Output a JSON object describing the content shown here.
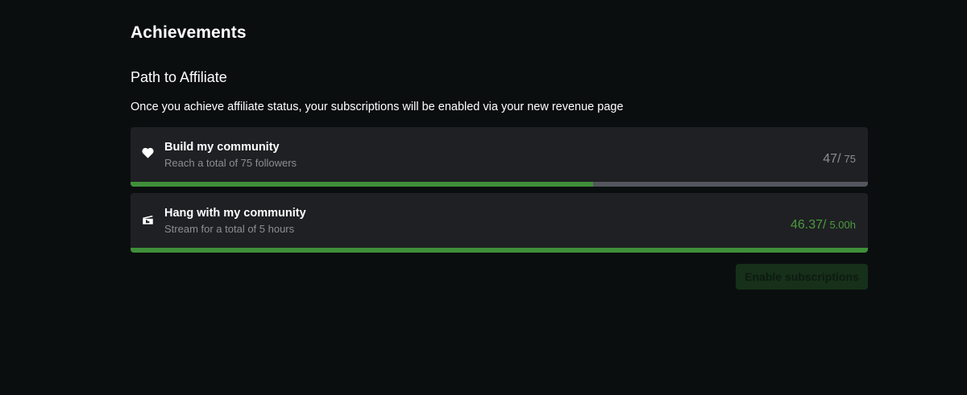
{
  "page": {
    "title": "Achievements"
  },
  "section": {
    "title": "Path to Affiliate",
    "description": "Once you achieve affiliate status, your subscriptions will be enabled via your new revenue page"
  },
  "achievements": [
    {
      "icon": "heart-icon",
      "name": "Build my community",
      "description": "Reach a total of 75 followers",
      "current": "47/",
      "target": "75",
      "progress_fraction": 0.627,
      "progress_color": "#3f8f3a",
      "value_color": "#8d8d93"
    },
    {
      "icon": "clapperboard-icon",
      "name": "Hang with my community",
      "description": "Stream for a total of 5 hours",
      "current": "46.37/",
      "target": "5.00h",
      "progress_fraction": 1.0,
      "progress_color": "#3f8f3a",
      "value_color": "#4a9a3e"
    }
  ],
  "actions": {
    "enable_subscriptions_label": "Enable subscriptions"
  },
  "colors": {
    "background": "#0b0e0f",
    "card": "#1f2023",
    "track": "#53565c",
    "accent": "#3f8f3a",
    "button_bg": "#16301a"
  }
}
